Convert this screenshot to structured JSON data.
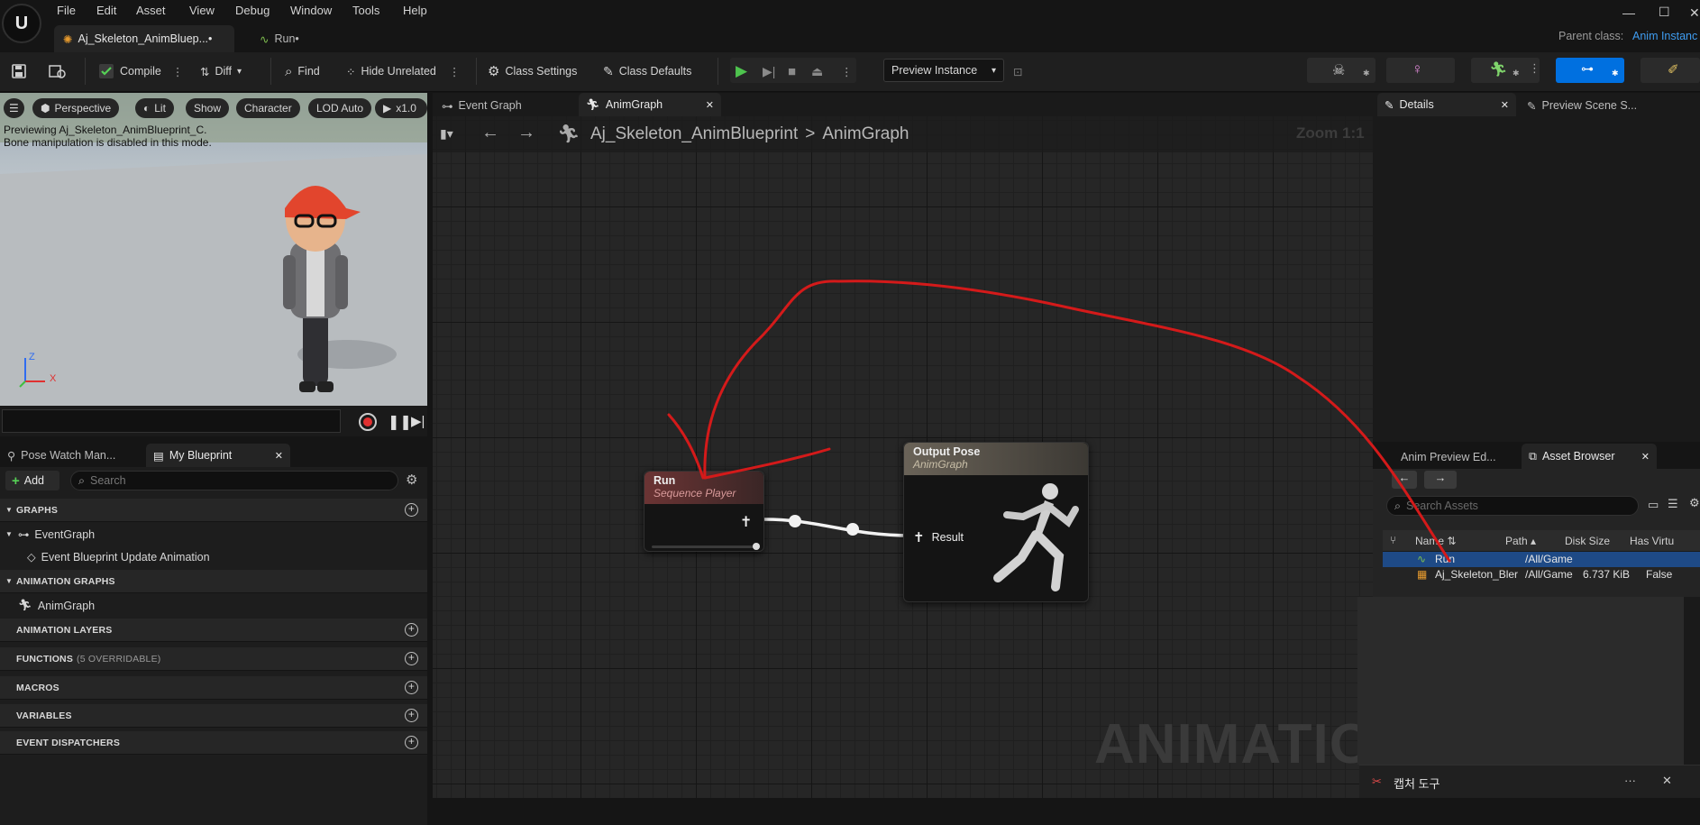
{
  "menu": [
    "File",
    "Edit",
    "Asset",
    "View",
    "Debug",
    "Window",
    "Tools",
    "Help"
  ],
  "parent_class": {
    "label": "Parent class:",
    "value": "Anim Instanc"
  },
  "tabs": {
    "main": "Aj_Skeleton_AnimBluep...•",
    "run": "Run•"
  },
  "toolbar": {
    "compile": "Compile",
    "diff": "Diff",
    "find": "Find",
    "hide_unrelated": "Hide Unrelated",
    "class_settings": "Class Settings",
    "class_defaults": "Class Defaults",
    "preview_instance": "Preview Instance"
  },
  "viewport": {
    "perspective": "Perspective",
    "lit": "Lit",
    "show": "Show",
    "character": "Character",
    "lod": "LOD Auto",
    "speed": "x1.0",
    "message_line1": "Previewing Aj_Skeleton_AnimBlueprint_C.",
    "message_line2": "Bone manipulation is disabled in this mode.",
    "axis_z": "Z",
    "axis_x": "X"
  },
  "left_tabs": {
    "pose_watch": "Pose Watch Man...",
    "my_blueprint": "My Blueprint"
  },
  "mybp": {
    "add": "Add",
    "search_placeholder": "Search",
    "graphs": "GRAPHS",
    "event_graph": "EventGraph",
    "event_update": "Event Blueprint Update Animation",
    "animation_graphs": "ANIMATION GRAPHS",
    "anim_graph": "AnimGraph",
    "animation_layers": "ANIMATION LAYERS",
    "functions": "FUNCTIONS",
    "functions_count": "(5 OVERRIDABLE)",
    "macros": "MACROS",
    "variables": "VARIABLES",
    "event_dispatchers": "EVENT DISPATCHERS"
  },
  "graph": {
    "tab_event": "Event Graph",
    "tab_anim": "AnimGraph",
    "crumb_bp": "Aj_Skeleton_AnimBlueprint",
    "crumb_sep": ">",
    "crumb_graph": "AnimGraph",
    "zoom": "Zoom 1:1",
    "watermark": "ANIMATION"
  },
  "node_run": {
    "title": "Run",
    "subtitle": "Sequence Player"
  },
  "node_output": {
    "title": "Output Pose",
    "subtitle": "AnimGraph",
    "pin": "Result"
  },
  "right": {
    "details": "Details",
    "preview_scene": "Preview Scene S...",
    "anim_preview": "Anim Preview Ed...",
    "asset_browser": "Asset Browser",
    "search_placeholder": "Search Assets",
    "columns": {
      "name": "Name",
      "path": "Path",
      "disk_size": "Disk Size",
      "has_virtual": "Has Virtu"
    },
    "rows": [
      {
        "name": "Run",
        "path": "/All/Game",
        "disk_size": "",
        "has_virtual": ""
      },
      {
        "name": "Aj_Skeleton_Bler",
        "path": "/All/Game",
        "disk_size": "6.737 KiB",
        "has_virtual": "False"
      }
    ]
  },
  "capture_tool": {
    "title": "캡처 도구",
    "more": "···",
    "close": "✕"
  },
  "colors": {
    "accent_blue": "#0070e0",
    "play_green": "#4ec44e",
    "annotation_red": "#d41a1a",
    "node_run_header": "#6b3434",
    "node_output_header": "#6a6358"
  }
}
